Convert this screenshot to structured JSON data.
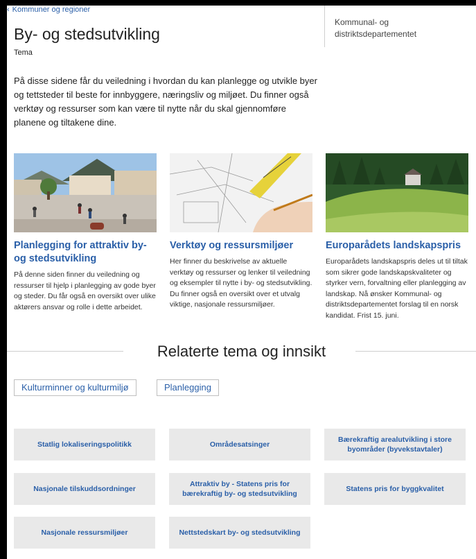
{
  "breadcrumb": {
    "label": "Kommuner og regioner"
  },
  "page": {
    "title": "By- og stedsutvikling",
    "subtitle": "Tema",
    "intro": "På disse sidene får du veiledning i hvordan du kan planlegge og utvikle byer og tettsteder til beste for innbyggere, næringsliv og miljøet. Du finner også verktøy og ressurser som kan være til nytte når du skal gjennomføre planene og tiltakene dine."
  },
  "sidebar": {
    "department": "Kommunal- og distriktsdepartementet"
  },
  "cards": [
    {
      "title": "Planlegging for attraktiv by- og stedsutvikling",
      "text": "På denne siden finner du veiledning og ressurser til hjelp i planlegging av gode byer og steder. Du får også en oversikt over ulike aktørers ansvar og rolle i dette arbeidet."
    },
    {
      "title": "Verktøy og ressursmiljøer",
      "text": "Her finner du beskrivelse av aktuelle verktøy og ressurser og lenker til veiledning og eksempler til nytte i by- og stedsutvikling. Du finner også en oversikt over et utvalg viktige, nasjonale ressursmiljøer."
    },
    {
      "title": "Europarådets landskapspris",
      "text": "Europarådets landskapspris deles ut til tiltak som sikrer gode landskapskvaliteter og styrker vern, forvaltning eller planlegging av landskap. Nå ønsker Kommunal- og distriktsdepartementet forslag til en norsk kandidat. Frist 15. juni."
    }
  ],
  "related": {
    "title": "Relaterte tema og innsikt",
    "tags": [
      "Kulturminner og kulturmiljø",
      "Planlegging"
    ],
    "links": [
      "Statlig lokaliseringspolitikk",
      "Områdesatsinger",
      "Bærekraftig arealutvikling i store byområder (byvekstavtaler)",
      "Nasjonale tilskuddsordninger",
      "Attraktiv by - Statens pris for bærekraftig by- og stedsutvikling",
      "Statens pris for byggkvalitet",
      "Nasjonale ressursmiljøer",
      "Nettstedskart by- og stedsutvikling"
    ]
  }
}
